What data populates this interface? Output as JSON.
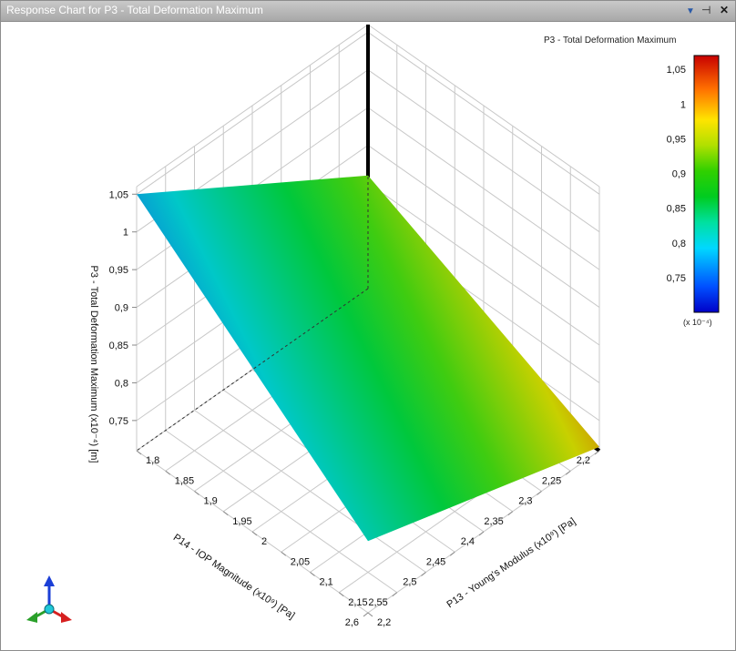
{
  "window": {
    "title": "Response Chart for P3 - Total Deformation Maximum",
    "colors": {
      "titlebar": "#b3b3b3",
      "title_text": "#ffffff"
    }
  },
  "chart_data": {
    "type": "surface3d",
    "zlabel": "P3 - Total Deformation Maximum  (x10⁻⁴)  [m]",
    "xlabel": "P14 - IOP Magnitude (x10⁹)  [Pa]",
    "ylabel": "P13 - Young's Modulus (x10⁹)  [Pa]",
    "z_ticks": [
      "0,75",
      "0,8",
      "0,85",
      "0,9",
      "0,95",
      "1",
      "1,05"
    ],
    "x_ticks": [
      "2,2",
      "2,25",
      "2,3",
      "2,35",
      "2,4",
      "2,45",
      "2,5",
      "2,55",
      "2,6"
    ],
    "y_ticks": [
      "1,8",
      "1,85",
      "1,9",
      "1,95",
      "2",
      "2,05",
      "2,1",
      "2,15",
      "2,2"
    ],
    "xlim": [
      2.2,
      2.6
    ],
    "ylim": [
      1.8,
      2.2
    ],
    "zlim": [
      0.71,
      1.06
    ],
    "surface": {
      "x": [
        2.2,
        2.6
      ],
      "y": [
        1.8,
        2.2
      ],
      "z": [
        [
          0.86,
          1.05
        ],
        [
          0.715,
          0.805
        ]
      ],
      "note_order": "z[i][j] with i over y (Young's Modulus), j over x (IOP Magnitude)"
    },
    "colorbar": {
      "title": "P3 - Total Deformation Maximum",
      "ticks": [
        "1,05",
        "1",
        "0,95",
        "0,9",
        "0,85",
        "0,8",
        "0,75"
      ],
      "multiplier": "(x 10⁻⁴)",
      "colormap": [
        "#0000c0",
        "#0060ff",
        "#00c8ff",
        "#00e0a0",
        "#00cc30",
        "#40d800",
        "#b8e000",
        "#ffe000",
        "#ff8000",
        "#e02000",
        "#c00000"
      ]
    },
    "grid": true
  }
}
